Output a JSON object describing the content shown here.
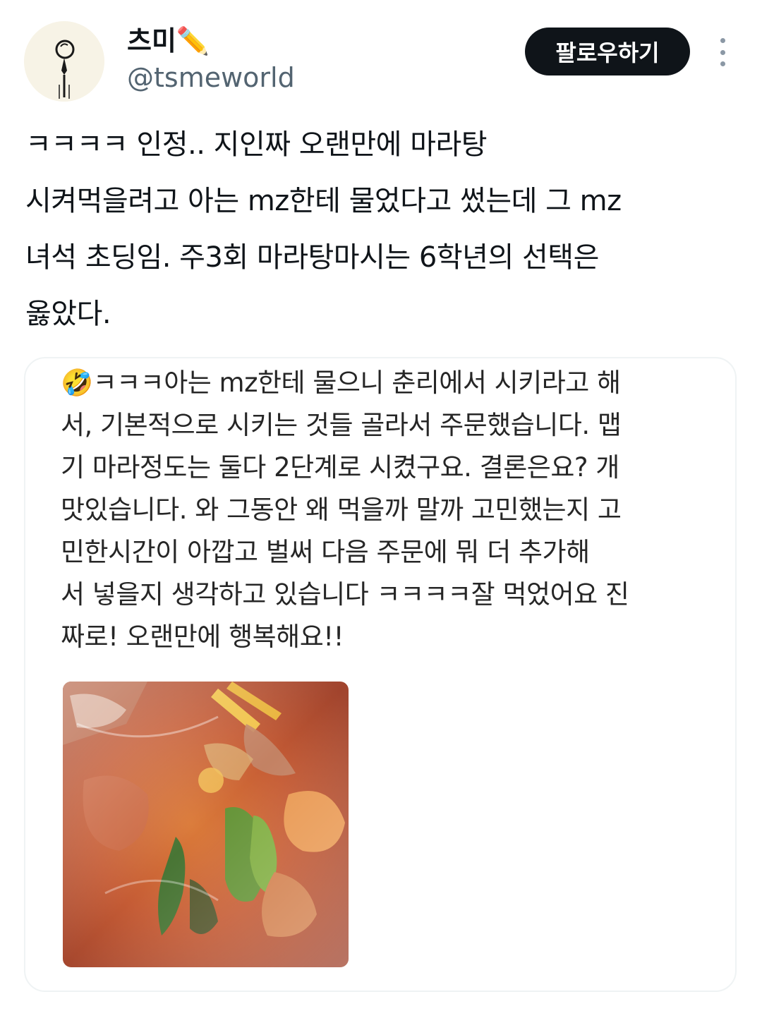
{
  "author": {
    "display_name": "츠미",
    "name_emoji": "✏️",
    "handle": "@tsmeworld",
    "avatar_icon": "ink-pen-doodle-avatar"
  },
  "header": {
    "follow_label": "팔로우하기",
    "more_icon": "more-vertical-icon"
  },
  "tweet": {
    "text": "ㅋㅋㅋㅋ 인정.. 지인짜 오랜만에 마라탕\n시켜먹을려고 아는 mz한테 물었다고 썼는데 그 mz\n녀석 초딩임. 주3회 마라탕마시는 6학년의 선택은\n옳았다."
  },
  "quoted_image": {
    "text": "🤣ㅋㅋㅋ아는 mz한테 물으니 춘리에서 시키라고 해\n서, 기본적으로 시키는 것들 골라서 주문했습니다. 맵\n기 마라정도는 둘다 2단계로 시켰구요. 결론은요? 개\n맛있습니다. 와 그동안 왜 먹을까 말까 고민했는지 고\n민한시간이 아깝고 벌써 다음 주문에 뭐 더 추가해\n서 넣을지 생각하고 있습니다 ㅋㅋㅋㅋ잘 먹었어요 진\n짜로! 오랜만에 행복해요!!",
    "photo": "malatang-photo"
  },
  "colors": {
    "text_primary": "#0f1419",
    "text_secondary": "#536471",
    "follow_bg": "#0f1419",
    "card_border": "#eff3f4"
  }
}
